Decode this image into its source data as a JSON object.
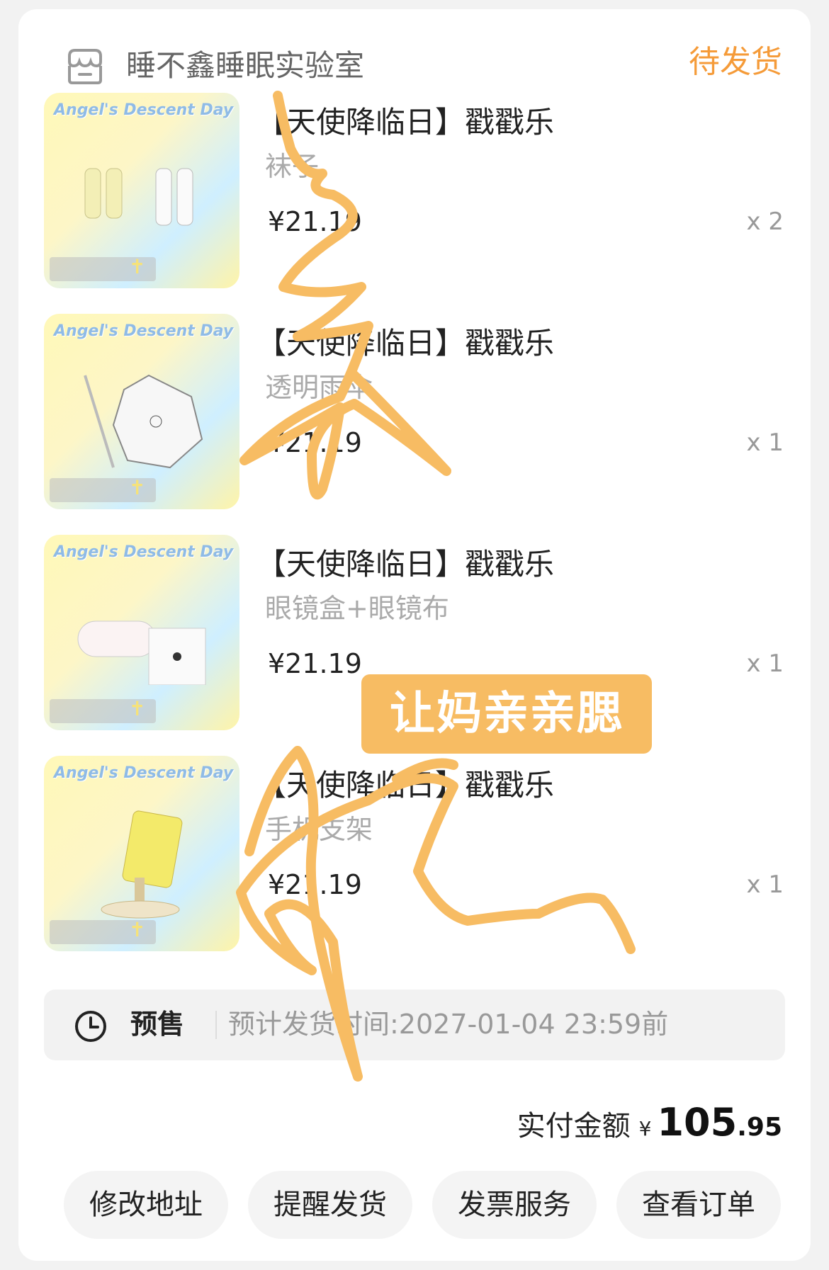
{
  "store": {
    "name": "睡不鑫睡眠实验室",
    "icon": "store-icon"
  },
  "order_status": "待发货",
  "items": [
    {
      "title": "【天使降临日】戳戳乐",
      "variant": "袜子",
      "price": "¥21.19",
      "qty": "x 2",
      "image_icon": "socks-product-image"
    },
    {
      "title": "【天使降临日】戳戳乐",
      "variant": "透明雨伞",
      "price": "¥21.19",
      "qty": "x 1",
      "image_icon": "umbrella-product-image"
    },
    {
      "title": "【天使降临日】戳戳乐",
      "variant": "眼镜盒+眼镜布",
      "price": "¥21.19",
      "qty": "x 1",
      "image_icon": "glasses-case-product-image"
    },
    {
      "title": "【天使降临日】戳戳乐",
      "variant": "手机支架",
      "price": "¥21.19",
      "qty": "x 1",
      "image_icon": "phone-stand-product-image"
    }
  ],
  "thumb_logo": "Angel's Descent Day",
  "presale": {
    "label": "预售",
    "text": "预计发货时间:2027-01-04 23:59前",
    "icon": "clock-icon"
  },
  "total": {
    "label": "实付金额",
    "currency": "¥",
    "integer": "105",
    "decimal": ".95"
  },
  "buttons": [
    "修改地址",
    "提醒发货",
    "发票服务",
    "查看订单"
  ],
  "sticker_text": "让妈亲亲腮",
  "colors": {
    "accent_orange": "#f59b39",
    "scribble": "#f7bc63"
  }
}
